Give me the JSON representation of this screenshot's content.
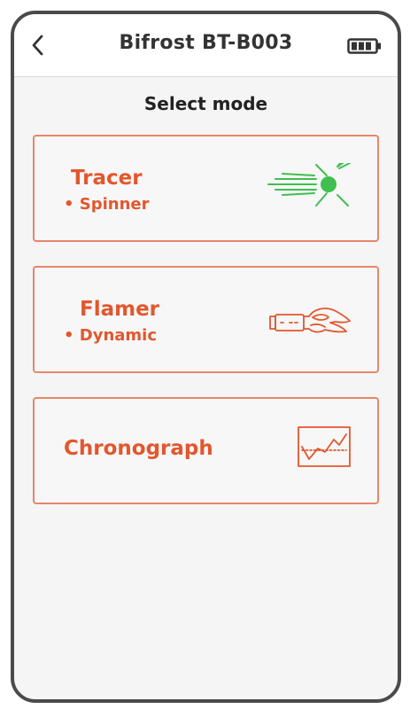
{
  "header": {
    "title": "Bifrost BT-B003",
    "back_icon": "chevron-left-icon",
    "battery_icon": "battery-full-icon"
  },
  "main": {
    "section_title": "Select mode",
    "modes": [
      {
        "title": "Tracer",
        "subtitle": "• Spinner",
        "icon": "tracer-burst-icon"
      },
      {
        "title": "Flamer",
        "subtitle": "• Dynamic",
        "icon": "flamer-nozzle-icon"
      },
      {
        "title": "Chronograph",
        "icon": "chart-icon"
      }
    ]
  },
  "colors": {
    "accent": "#e2572e",
    "card_border": "#e8866a",
    "tracer_green": "#3fbf4f",
    "frame": "#4a4a4a"
  }
}
